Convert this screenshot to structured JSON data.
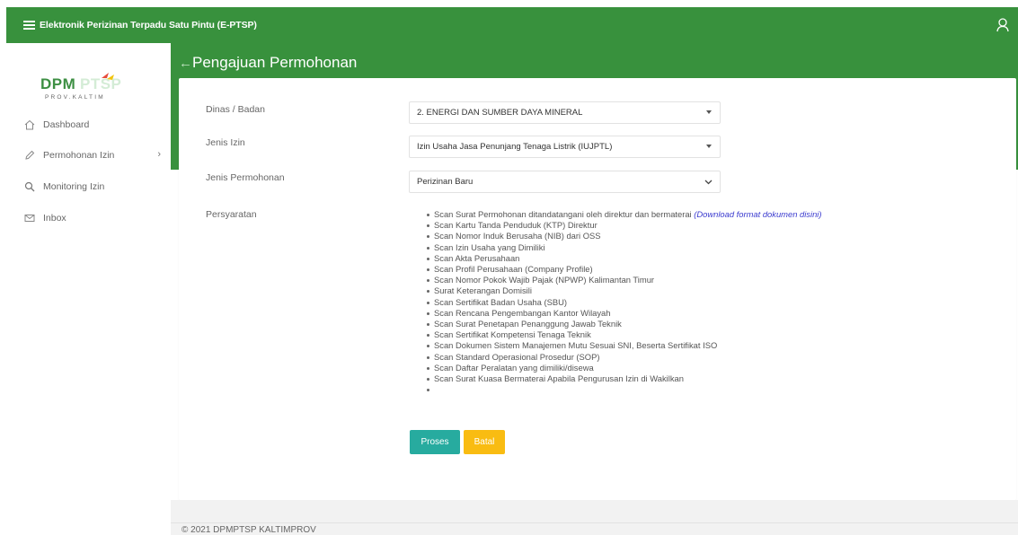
{
  "app": {
    "title": "Elektronik Perizinan Terpadu Satu Pintu (E-PTSP)"
  },
  "logo": {
    "main": "DPMPTSP",
    "sub": "PROV.KALTIM"
  },
  "sidebar": {
    "items": [
      {
        "label": "Dashboard",
        "icon": "home-icon"
      },
      {
        "label": "Permohonan Izin",
        "icon": "pencil-icon",
        "chevron": "›"
      },
      {
        "label": "Monitoring Izin",
        "icon": "search-icon"
      },
      {
        "label": "Inbox",
        "icon": "mail-icon"
      }
    ]
  },
  "header": {
    "title": "Pengajuan Permohonan"
  },
  "form": {
    "dinas": {
      "label": "Dinas / Badan",
      "value": "2. ENERGI DAN SUMBER DAYA MINERAL"
    },
    "jenis_izin": {
      "label": "Jenis Izin",
      "value": "Izin Usaha Jasa Penunjang Tenaga Listrik (IUJPTL)"
    },
    "jenis_permohonan": {
      "label": "Jenis Permohonan",
      "value": "Perizinan Baru"
    },
    "persyaratan": {
      "label": "Persyaratan",
      "first_item": "Scan Surat Permohonan ditandatangani oleh direktur dan bermaterai ",
      "download_link": "(Download format dokumen disini)",
      "items": [
        "Scan Kartu Tanda Penduduk (KTP) Direktur",
        "Scan Nomor Induk Berusaha (NIB) dari OSS",
        "Scan Izin Usaha yang Dimiliki",
        "Scan Akta Perusahaan",
        "Scan Profil Perusahaan (Company Profile)",
        "Scan Nomor Pokok Wajib Pajak (NPWP) Kalimantan Timur",
        "Surat Keterangan Domisili",
        "Scan Sertifikat Badan Usaha (SBU)",
        "Scan Rencana Pengembangan Kantor Wilayah",
        "Scan Surat Penetapan Penanggung Jawab Teknik",
        "Scan Sertifikat Kompetensi Tenaga Teknik",
        "Scan Dokumen Sistem Manajemen Mutu Sesuai SNI, Beserta Sertifikat ISO",
        "Scan Standard Operasional Prosedur (SOP)",
        "Scan Daftar Peralatan yang dimiliki/disewa",
        "Scan Surat Kuasa Bermaterai Apabila Pengurusan Izin di Wakilkan"
      ]
    },
    "buttons": {
      "proses": "Proses",
      "batal": "Batal"
    }
  },
  "footer": {
    "text": "© 2021 DPMPTSP KALTIMPROV"
  },
  "colors": {
    "primary": "#38913d",
    "proses": "#27ab9f",
    "batal": "#f9bc12",
    "link": "#3b3bcf"
  }
}
